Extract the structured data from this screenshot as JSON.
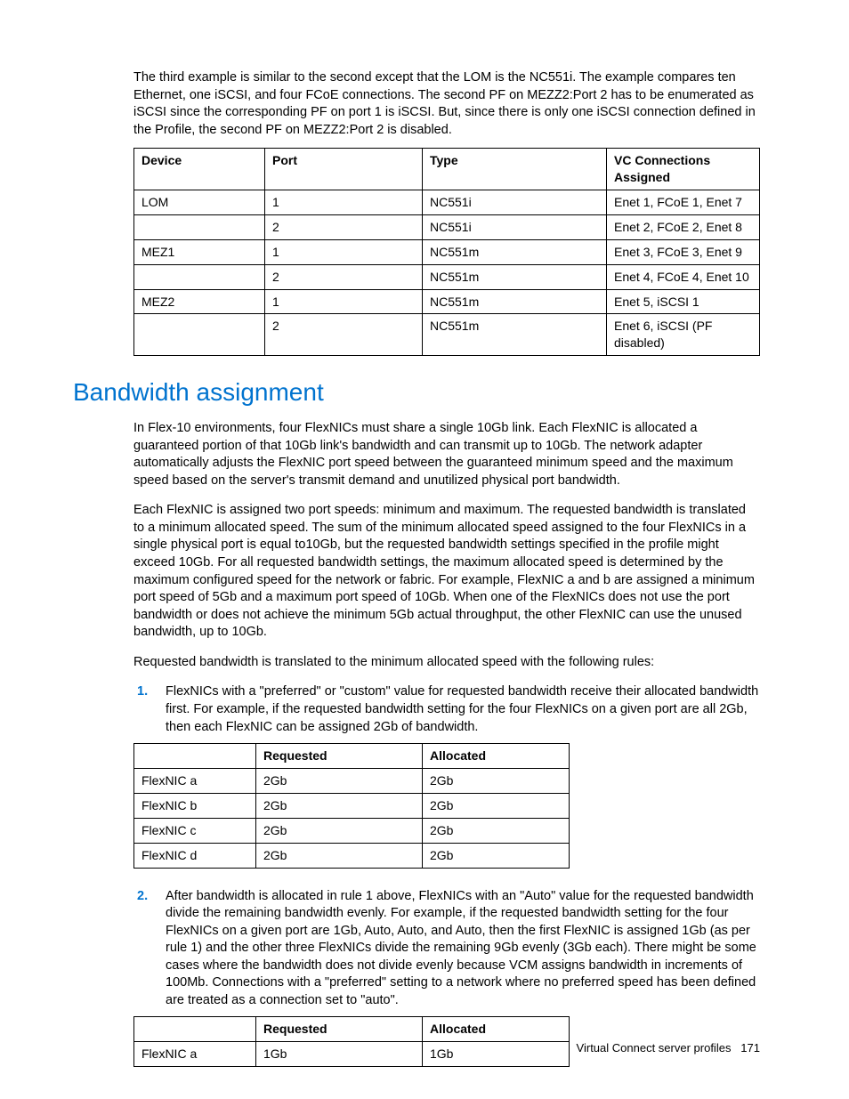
{
  "intro_paragraph": "The third example is similar to the second except that the LOM is the NC551i. The example compares ten Ethernet, one iSCSI, and four FCoE connections. The second PF on MEZZ2:Port 2 has to be enumerated as iSCSI since the corresponding PF on port 1 is iSCSI. But, since there is only one iSCSI connection defined in the Profile, the second PF on MEZZ2:Port 2 is disabled.",
  "table1": {
    "headers": [
      "Device",
      "Port",
      "Type",
      "VC Connections Assigned"
    ],
    "rows": [
      [
        "LOM",
        "1",
        "NC551i",
        "Enet 1, FCoE 1, Enet 7"
      ],
      [
        "",
        "2",
        "NC551i",
        "Enet 2, FCoE 2, Enet 8"
      ],
      [
        "MEZ1",
        "1",
        "NC551m",
        "Enet 3, FCoE 3, Enet 9"
      ],
      [
        "",
        "2",
        "NC551m",
        "Enet 4, FCoE 4, Enet 10"
      ],
      [
        "MEZ2",
        "1",
        "NC551m",
        "Enet 5, iSCSI 1"
      ],
      [
        "",
        "2",
        "NC551m",
        "Enet 6, iSCSI (PF disabled)"
      ]
    ]
  },
  "section_heading": "Bandwidth assignment",
  "para1": "In Flex-10 environments, four FlexNICs must share a single 10Gb link. Each FlexNIC is allocated a guaranteed portion of that 10Gb link's bandwidth and can transmit up to 10Gb. The network adapter automatically adjusts the FlexNIC port speed between the guaranteed minimum speed and the maximum speed based on the server's transmit demand and unutilized physical port bandwidth.",
  "para2": "Each FlexNIC is assigned two port speeds: minimum and maximum. The requested bandwidth is translated to a minimum allocated speed. The sum of the minimum allocated speed assigned to the four FlexNICs in a single physical port is equal to10Gb, but the requested bandwidth settings specified in the profile might exceed 10Gb. For all requested bandwidth settings, the maximum allocated speed is determined by the maximum configured speed for the network or fabric. For example, FlexNIC a and b are assigned a minimum port speed of 5Gb and a maximum port speed of 10Gb. When one of the FlexNICs does not use the port bandwidth or does not achieve the minimum 5Gb actual throughput, the other FlexNIC can use the unused bandwidth, up to 10Gb.",
  "para3": "Requested bandwidth is translated to the minimum allocated speed with the following rules:",
  "rule1": "FlexNICs with a \"preferred\" or \"custom\" value for requested bandwidth receive their allocated bandwidth first. For example, if the requested bandwidth setting for the four FlexNICs on a given port are all 2Gb, then each FlexNIC can be assigned 2Gb of bandwidth.",
  "table2": {
    "headers": [
      "",
      "Requested",
      "Allocated"
    ],
    "rows": [
      [
        "FlexNIC a",
        "2Gb",
        "2Gb"
      ],
      [
        "FlexNIC b",
        "2Gb",
        "2Gb"
      ],
      [
        "FlexNIC c",
        "2Gb",
        "2Gb"
      ],
      [
        "FlexNIC d",
        "2Gb",
        "2Gb"
      ]
    ]
  },
  "rule2": "After bandwidth is allocated in rule 1 above, FlexNICs with an \"Auto\" value for the requested bandwidth divide the remaining bandwidth evenly. For example, if the requested bandwidth setting for the four FlexNICs on a given port are 1Gb, Auto, Auto, and Auto, then the first FlexNIC is assigned 1Gb (as per rule 1) and the other three FlexNICs divide the remaining 9Gb evenly (3Gb each). There might be some cases where the bandwidth does not divide evenly because VCM assigns bandwidth in increments of 100Mb. Connections with a \"preferred\" setting to a network where no preferred speed has been defined are treated as a connection set to \"auto\".",
  "table3": {
    "headers": [
      "",
      "Requested",
      "Allocated"
    ],
    "rows": [
      [
        "FlexNIC a",
        "1Gb",
        "1Gb"
      ]
    ]
  },
  "footer": {
    "text": "Virtual Connect server profiles",
    "page": "171"
  }
}
